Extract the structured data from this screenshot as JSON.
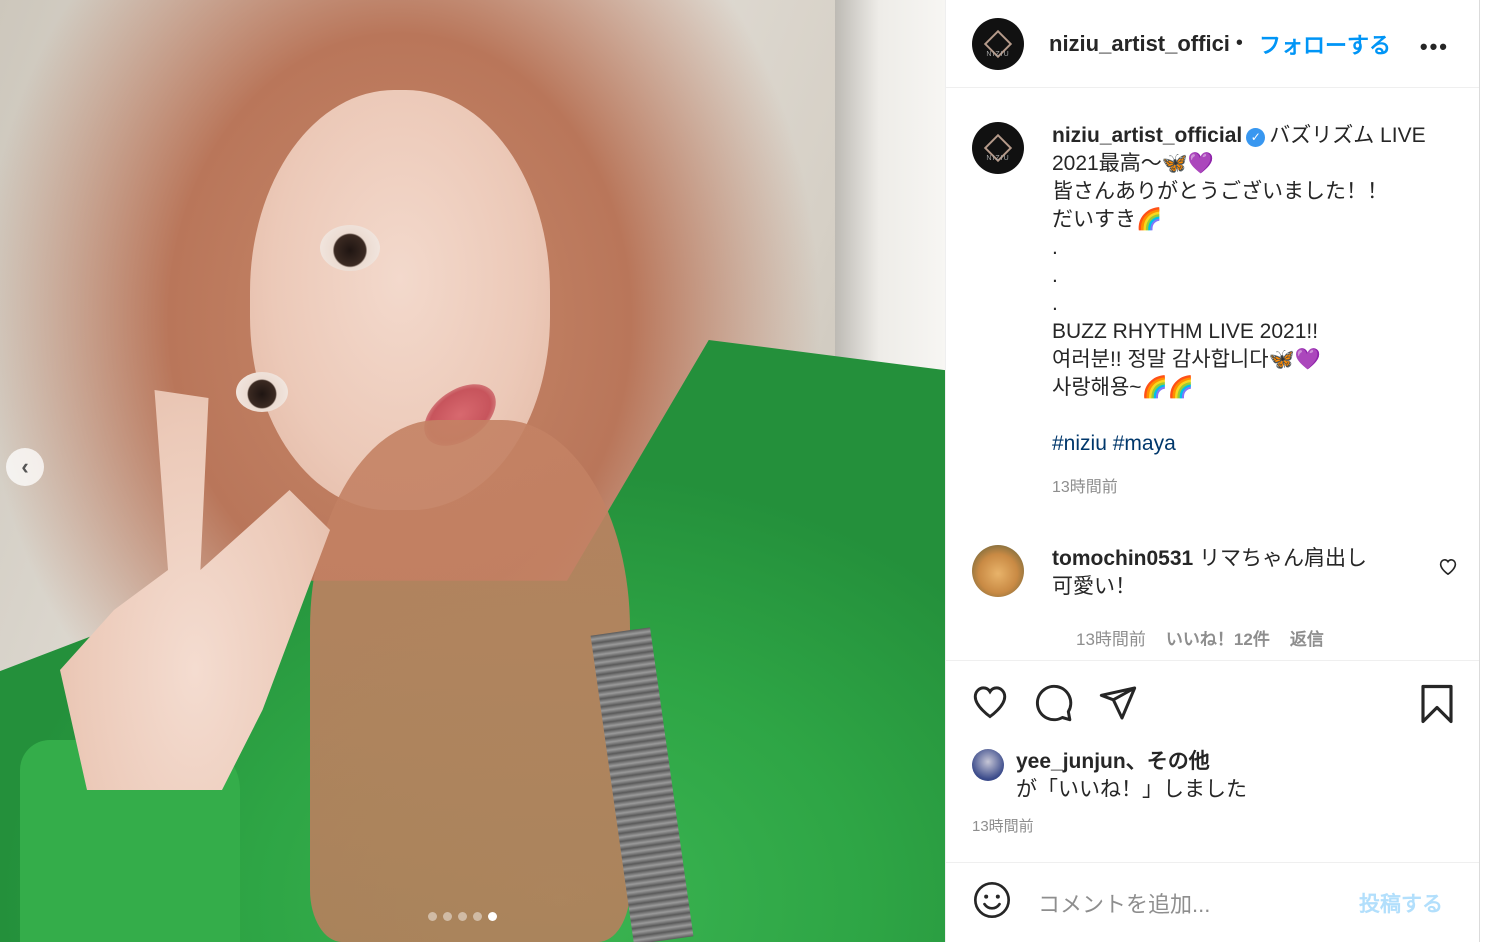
{
  "header": {
    "username": "niziu_artist_offici",
    "separator": "•",
    "follow_label": "フォローする",
    "more_icon": "more-icon"
  },
  "logo_text": "NIZIU",
  "caption": {
    "username": "niziu_artist_official",
    "lines": [
      "バズリズム LIVE",
      "2021最高〜🦋💜",
      "皆さんありがとうございました！！",
      "だいすき🌈",
      ".",
      ".",
      ".",
      "BUZZ RHYTHM LIVE 2021!!",
      "여러분!! 정말 감사합니다🦋💜",
      "사랑해용~🌈🌈",
      ""
    ],
    "hashtags": [
      "#niziu",
      "#maya"
    ],
    "time": "13時間前"
  },
  "comment": {
    "username": "tomochin0531",
    "text_line1": "リマちゃん肩出し",
    "text_line2": "可愛い！",
    "time": "13時間前",
    "likes": "いいね！12件",
    "reply": "返信"
  },
  "likes": {
    "user": "yee_junjun",
    "others": "、その他",
    "line2": "が「いいね！」しました"
  },
  "post_time": "13時間前",
  "add_comment": {
    "placeholder": "コメントを追加...",
    "post_label": "投稿する"
  },
  "carousel": {
    "total": 5,
    "active_index": 5
  },
  "colors": {
    "link_blue": "#0095f6",
    "post_disabled": "#b2dffc",
    "hashtag": "#00376b",
    "muted": "#8e8e8e"
  }
}
